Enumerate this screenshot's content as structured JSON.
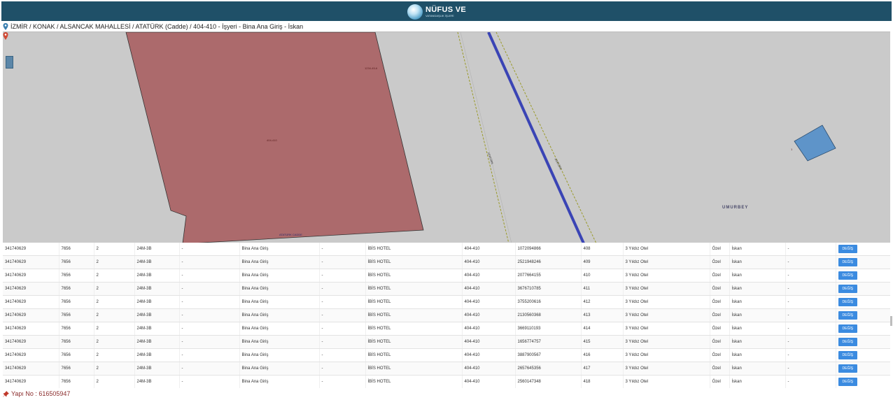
{
  "header": {
    "logo_text": "NÜFUS VE",
    "logo_sub": "VATANDAŞLIK İŞLERİ"
  },
  "breadcrumb": {
    "icon": "map-pin-icon",
    "text": "İZMİR / KONAK / ALSANCAK MAHALLESİ / ATATÜRK (Cadde) / 404-410 - İşyeri - Bina Ana Giriş - İskan"
  },
  "map": {
    "labels": {
      "parcel_top": "1234-45-6",
      "parcel_center": "404-410",
      "parcel_bottom": "ATATÜRK CADDE",
      "line_a": "ATATÜRK",
      "line_b": "ATATÜRK",
      "street_right": "UMURBEY",
      "small_building": "1"
    },
    "colors": {
      "parcel": "#ac6a6c",
      "road": "#3a44b5",
      "building": "#5e94c9",
      "background": "#cacaca"
    }
  },
  "table": {
    "rows": [
      {
        "c1": "341740629",
        "c2": "7656",
        "c3": "2",
        "c4": "24M-3B",
        "c5": "-",
        "c6": "Bina Ana Giriş",
        "c7": "-",
        "c8": "İBİS HOTEL",
        "c9": "404-410",
        "c10": "1072094866",
        "c11": "408",
        "c12": "3 Yıldız Otel",
        "c13": "Özel",
        "c14": "İskan",
        "c15": "-",
        "btn": "DEĞİŞ"
      },
      {
        "c1": "341740629",
        "c2": "7656",
        "c3": "2",
        "c4": "24M-3B",
        "c5": "-",
        "c6": "Bina Ana Giriş",
        "c7": "-",
        "c8": "İBİS HOTEL",
        "c9": "404-410",
        "c10": "2521948246",
        "c11": "409",
        "c12": "3 Yıldız Otel",
        "c13": "Özel",
        "c14": "İskan",
        "c15": "-",
        "btn": "DEĞİŞ"
      },
      {
        "c1": "341740629",
        "c2": "7656",
        "c3": "2",
        "c4": "24M-3B",
        "c5": "-",
        "c6": "Bina Ana Giriş",
        "c7": "-",
        "c8": "İBİS HOTEL",
        "c9": "404-410",
        "c10": "2077664155",
        "c11": "410",
        "c12": "3 Yıldız Otel",
        "c13": "Özel",
        "c14": "İskan",
        "c15": "-",
        "btn": "DEĞİŞ"
      },
      {
        "c1": "341740629",
        "c2": "7656",
        "c3": "2",
        "c4": "24M-3B",
        "c5": "-",
        "c6": "Bina Ana Giriş",
        "c7": "-",
        "c8": "İBİS HOTEL",
        "c9": "404-410",
        "c10": "3676710785",
        "c11": "411",
        "c12": "3 Yıldız Otel",
        "c13": "Özel",
        "c14": "İskan",
        "c15": "-",
        "btn": "DEĞİŞ"
      },
      {
        "c1": "341740629",
        "c2": "7656",
        "c3": "2",
        "c4": "24M-3B",
        "c5": "-",
        "c6": "Bina Ana Giriş",
        "c7": "-",
        "c8": "İBİS HOTEL",
        "c9": "404-410",
        "c10": "3755200616",
        "c11": "412",
        "c12": "3 Yıldız Otel",
        "c13": "Özel",
        "c14": "İskan",
        "c15": "-",
        "btn": "DEĞİŞ"
      },
      {
        "c1": "341740629",
        "c2": "7656",
        "c3": "2",
        "c4": "24M-3B",
        "c5": "-",
        "c6": "Bina Ana Giriş",
        "c7": "-",
        "c8": "İBİS HOTEL",
        "c9": "404-410",
        "c10": "2130560368",
        "c11": "413",
        "c12": "3 Yıldız Otel",
        "c13": "Özel",
        "c14": "İskan",
        "c15": "-",
        "btn": "DEĞİŞ"
      },
      {
        "c1": "341740629",
        "c2": "7656",
        "c3": "2",
        "c4": "24M-3B",
        "c5": "-",
        "c6": "Bina Ana Giriş",
        "c7": "-",
        "c8": "İBİS HOTEL",
        "c9": "404-410",
        "c10": "3669110193",
        "c11": "414",
        "c12": "3 Yıldız Otel",
        "c13": "Özel",
        "c14": "İskan",
        "c15": "-",
        "btn": "DEĞİŞ"
      },
      {
        "c1": "341740629",
        "c2": "7656",
        "c3": "2",
        "c4": "24M-3B",
        "c5": "-",
        "c6": "Bina Ana Giriş",
        "c7": "-",
        "c8": "İBİS HOTEL",
        "c9": "404-410",
        "c10": "1656774757",
        "c11": "415",
        "c12": "3 Yıldız Otel",
        "c13": "Özel",
        "c14": "İskan",
        "c15": "-",
        "btn": "DEĞİŞ"
      },
      {
        "c1": "341740629",
        "c2": "7656",
        "c3": "2",
        "c4": "24M-3B",
        "c5": "-",
        "c6": "Bina Ana Giriş",
        "c7": "-",
        "c8": "İBİS HOTEL",
        "c9": "404-410",
        "c10": "3887900567",
        "c11": "416",
        "c12": "3 Yıldız Otel",
        "c13": "Özel",
        "c14": "İskan",
        "c15": "-",
        "btn": "DEĞİŞ"
      },
      {
        "c1": "341740629",
        "c2": "7656",
        "c3": "2",
        "c4": "24M-3B",
        "c5": "-",
        "c6": "Bina Ana Giriş",
        "c7": "-",
        "c8": "İBİS HOTEL",
        "c9": "404-410",
        "c10": "2657645356",
        "c11": "417",
        "c12": "3 Yıldız Otel",
        "c13": "Özel",
        "c14": "İskan",
        "c15": "-",
        "btn": "DEĞİŞ"
      },
      {
        "c1": "341740629",
        "c2": "7656",
        "c3": "2",
        "c4": "24M-3B",
        "c5": "-",
        "c6": "Bina Ana Giriş",
        "c7": "-",
        "c8": "İBİS HOTEL",
        "c9": "404-410",
        "c10": "2560147348",
        "c11": "418",
        "c12": "3 Yıldız Otel",
        "c13": "Özel",
        "c14": "İskan",
        "c15": "-",
        "btn": "DEĞİŞ"
      }
    ]
  },
  "footer": {
    "icon": "pushpin-icon",
    "text": "Yapı No : 616505947"
  }
}
